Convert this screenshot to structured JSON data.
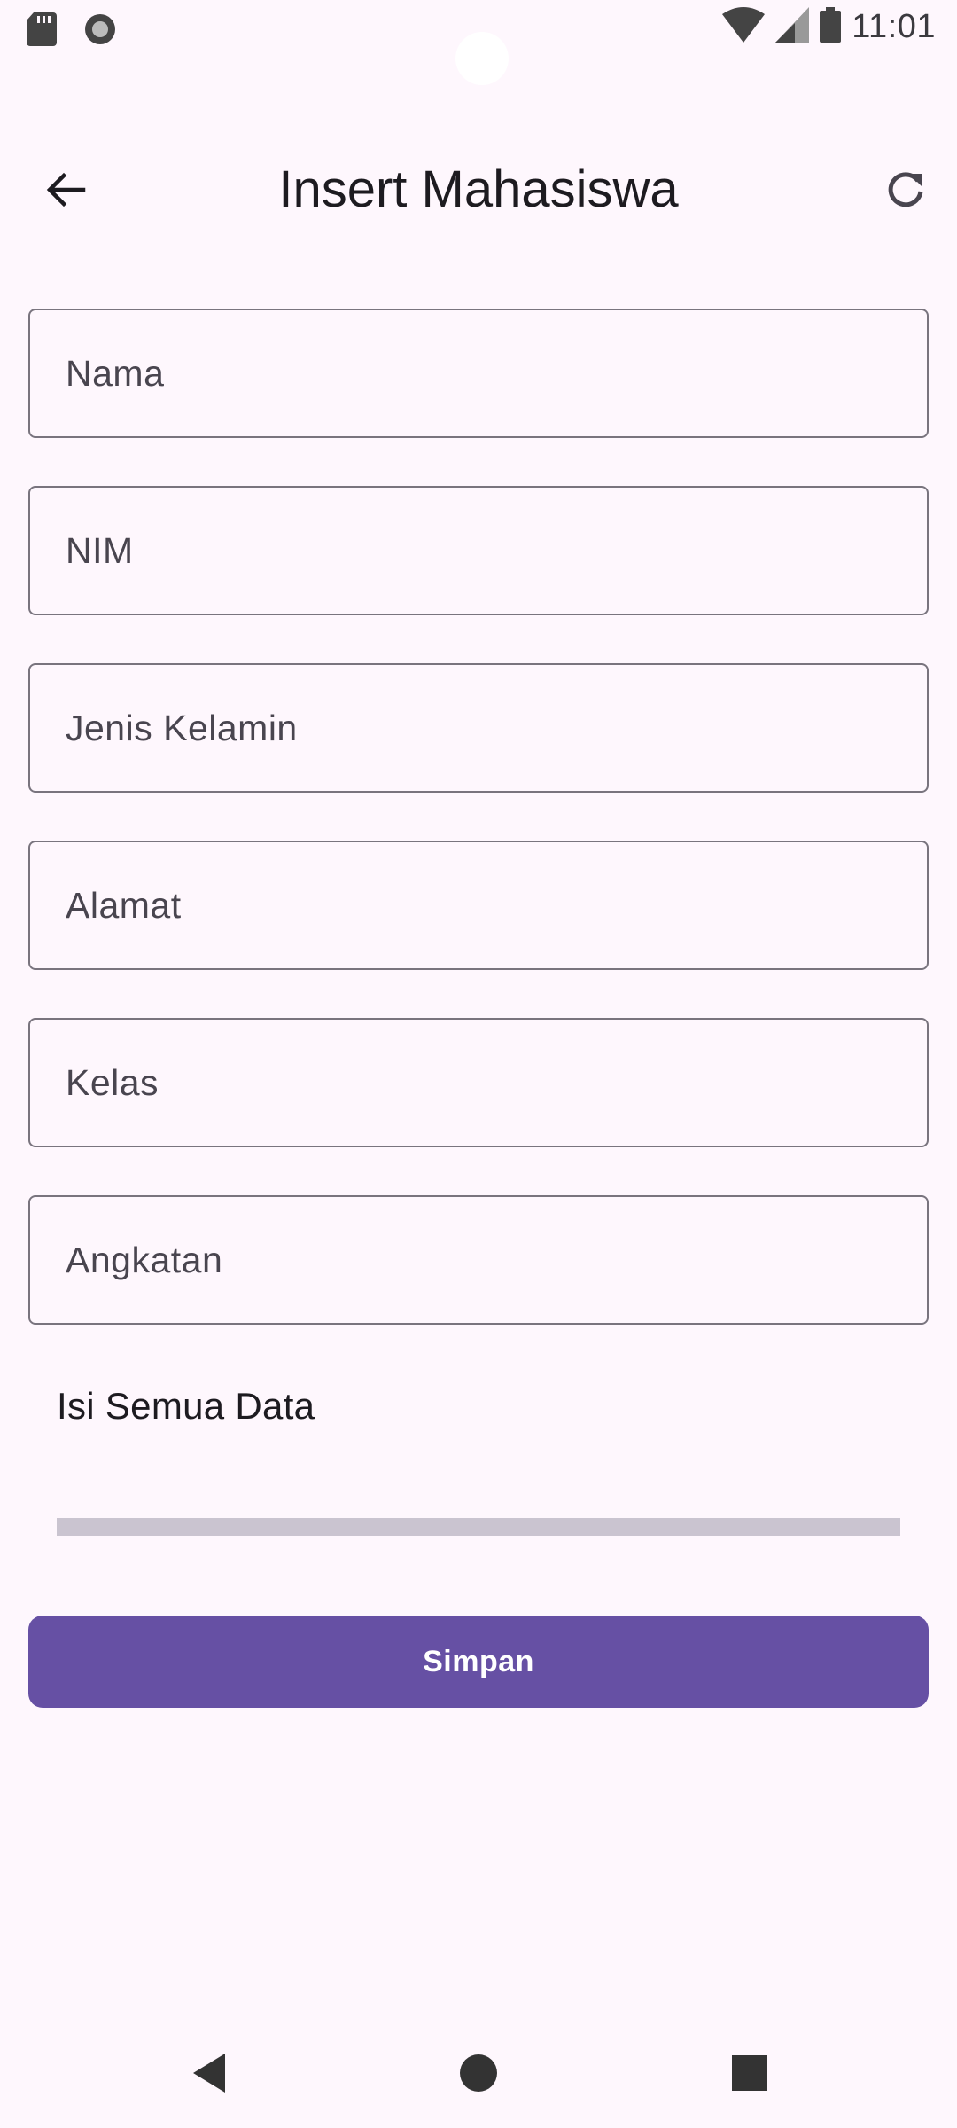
{
  "status_bar": {
    "time": "11:01",
    "left_icons": [
      "sd-card-icon",
      "record-icon"
    ],
    "right_icons": [
      "wifi-icon",
      "signal-icon",
      "battery-icon"
    ]
  },
  "app_bar": {
    "title": "Insert Mahasiswa",
    "back_icon": "arrow-back-icon",
    "refresh_icon": "refresh-icon"
  },
  "form": {
    "fields": [
      {
        "placeholder": "Nama",
        "value": ""
      },
      {
        "placeholder": "NIM",
        "value": ""
      },
      {
        "placeholder": "Jenis Kelamin",
        "value": ""
      },
      {
        "placeholder": "Alamat",
        "value": ""
      },
      {
        "placeholder": "Kelas",
        "value": ""
      },
      {
        "placeholder": "Angkatan",
        "value": ""
      }
    ],
    "error_message": "Isi Semua Data",
    "progress": 0,
    "submit_label": "Simpan"
  },
  "nav_bar": {
    "icons": [
      "nav-back-icon",
      "nav-home-icon",
      "nav-recents-icon"
    ]
  },
  "colors": {
    "background": "#fef7fd",
    "primary": "#6650a4",
    "outline": "#79747e",
    "progress_track": "#cac4d0"
  }
}
